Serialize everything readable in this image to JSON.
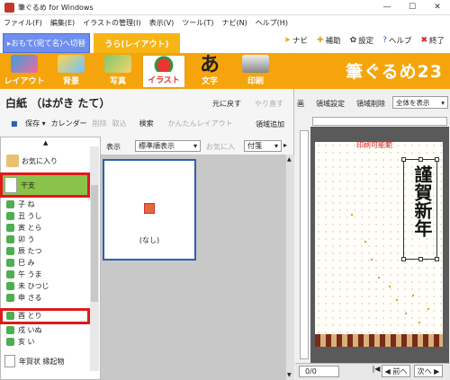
{
  "window": {
    "title": "筆ぐるめ for Windows",
    "min": "—",
    "max": "☐",
    "close": "✕"
  },
  "menu": [
    "ファイル(F)",
    "編集(E)",
    "イラストの管理(I)",
    "表示(V)",
    "ツール(T)",
    "ナビ(N)",
    "ヘルプ(H)"
  ],
  "tabs": {
    "front": "▸おもて(宛て名)へ切替",
    "back": "うら(レイアウト)"
  },
  "toplinks": {
    "navi": "ナビ",
    "hojo": "補助",
    "settei": "設定",
    "help": "ヘルプ",
    "exit": "終了"
  },
  "toolbar": {
    "layout": "レイアウト",
    "haikei": "背景",
    "shashin": "写真",
    "illust": "イラスト",
    "moji": "文字",
    "insatsu": "印刷",
    "brand": "筆ぐるめ23"
  },
  "left": {
    "title": "白紙 （はがき たて）",
    "undo": "元に戻す",
    "redo": "やり直す",
    "save": "保存",
    "calendar": "カレンダー",
    "delete": "削除",
    "import": "取込",
    "search": "検索",
    "easy_layout": "かんたんレイアウト",
    "area_add": "領域追加"
  },
  "categories": {
    "favorite": "お気に入り",
    "eto": "干支",
    "items": [
      "子 ね",
      "丑 うし",
      "寅 とら",
      "卯 う",
      "辰 たつ",
      "巳 み",
      "午 うま",
      "未 ひつじ",
      "申 さる",
      "酉 とり",
      "戌 いぬ",
      "亥 い"
    ],
    "nenga": "年賀状 縁起物"
  },
  "display": {
    "label": "表示",
    "sort": "標準順表示",
    "fav_in": "お気に入",
    "fusen": "付箋"
  },
  "gallery": {
    "item_none": "(なし)"
  },
  "right": {
    "t1": "画",
    "area_setting": "領域設定",
    "area_delete": "領域削除",
    "view": "全体を表示",
    "print_range": "印刷可能範",
    "greeting": "謹賀新年"
  },
  "nav": {
    "page": "0/0",
    "first": "|◀",
    "prev": "◀ 前へ",
    "next": "次へ ▶"
  },
  "colors": {
    "orange": "#f5a40b",
    "blue_tab": "#6f8ff0",
    "green_row": "#8bc34a",
    "highlight_red": "#e0191b"
  }
}
